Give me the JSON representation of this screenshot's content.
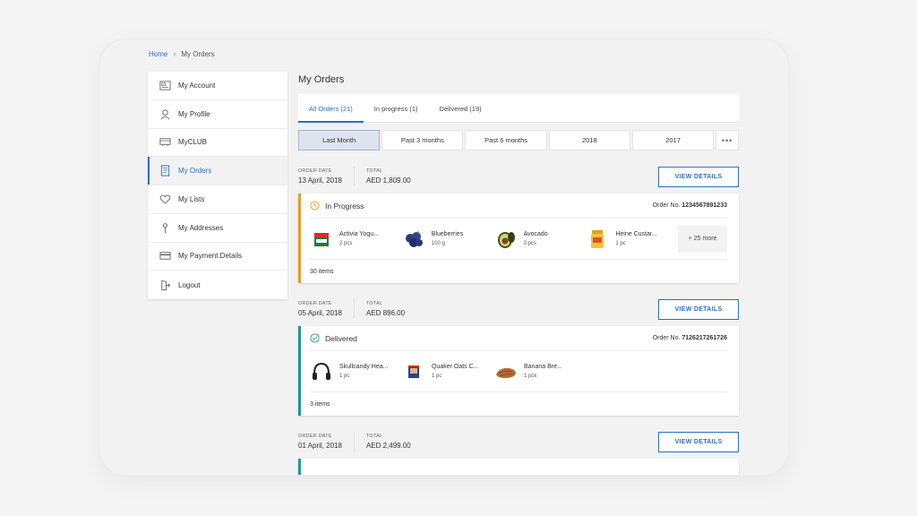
{
  "breadcrumb": {
    "home": "Home",
    "current": "My Orders"
  },
  "sidebar": {
    "items": [
      {
        "label": "My Account",
        "icon": "account-icon"
      },
      {
        "label": "My Profile",
        "icon": "profile-icon"
      },
      {
        "label": "MyCLUB",
        "icon": "club-icon"
      },
      {
        "label": "My Orders",
        "icon": "orders-icon",
        "active": true
      },
      {
        "label": "My Lists",
        "icon": "heart-icon"
      },
      {
        "label": "My Addresses",
        "icon": "pin-icon"
      },
      {
        "label": "My Payment Details",
        "icon": "card-icon"
      },
      {
        "label": "Logout",
        "icon": "logout-icon"
      }
    ]
  },
  "main": {
    "title": "My Orders",
    "tabs": [
      {
        "label": "All Orders (21)",
        "active": true
      },
      {
        "label": "In progress (1)"
      },
      {
        "label": "Delivered (19)"
      }
    ],
    "filters": [
      "Last Month",
      "Past 3 months",
      "Past 6 months",
      "2018",
      "2017"
    ],
    "filters_more": "•••",
    "labels": {
      "order_date": "ORDER DATE",
      "total": "TOTAL",
      "view_details": "VIEW DETAILS"
    },
    "orders": [
      {
        "date": "13 April, 2018",
        "total": "AED 1,809.00",
        "status": "In Progress",
        "order_no_label": "Order No.",
        "order_no": "1234567891233",
        "products": [
          {
            "name": "Activia Yogu...",
            "qty": "2 pcs"
          },
          {
            "name": "Blueberries",
            "qty": "100 g"
          },
          {
            "name": "Avocado",
            "qty": "3 pcs"
          },
          {
            "name": "Heine Custar...",
            "qty": "1 pc"
          }
        ],
        "more": "+ 25 more",
        "items": "30 items"
      },
      {
        "date": "05 April, 2018",
        "total": "AED 896.00",
        "status": "Delivered",
        "order_no_label": "Order No.",
        "order_no": "7126217261726",
        "products": [
          {
            "name": "Skullcandy Hea...",
            "qty": "1 pc"
          },
          {
            "name": "Quaker Oats C...",
            "qty": "1 pc"
          },
          {
            "name": "Banana Bre...",
            "qty": "1 pck"
          }
        ],
        "items": "3 items"
      },
      {
        "date": "01 April, 2018",
        "total": "AED 2,499.00"
      }
    ]
  },
  "colors": {
    "accent": "#2a6fc0",
    "in_progress": "#e79b2a",
    "delivered": "#1a9c8e"
  }
}
